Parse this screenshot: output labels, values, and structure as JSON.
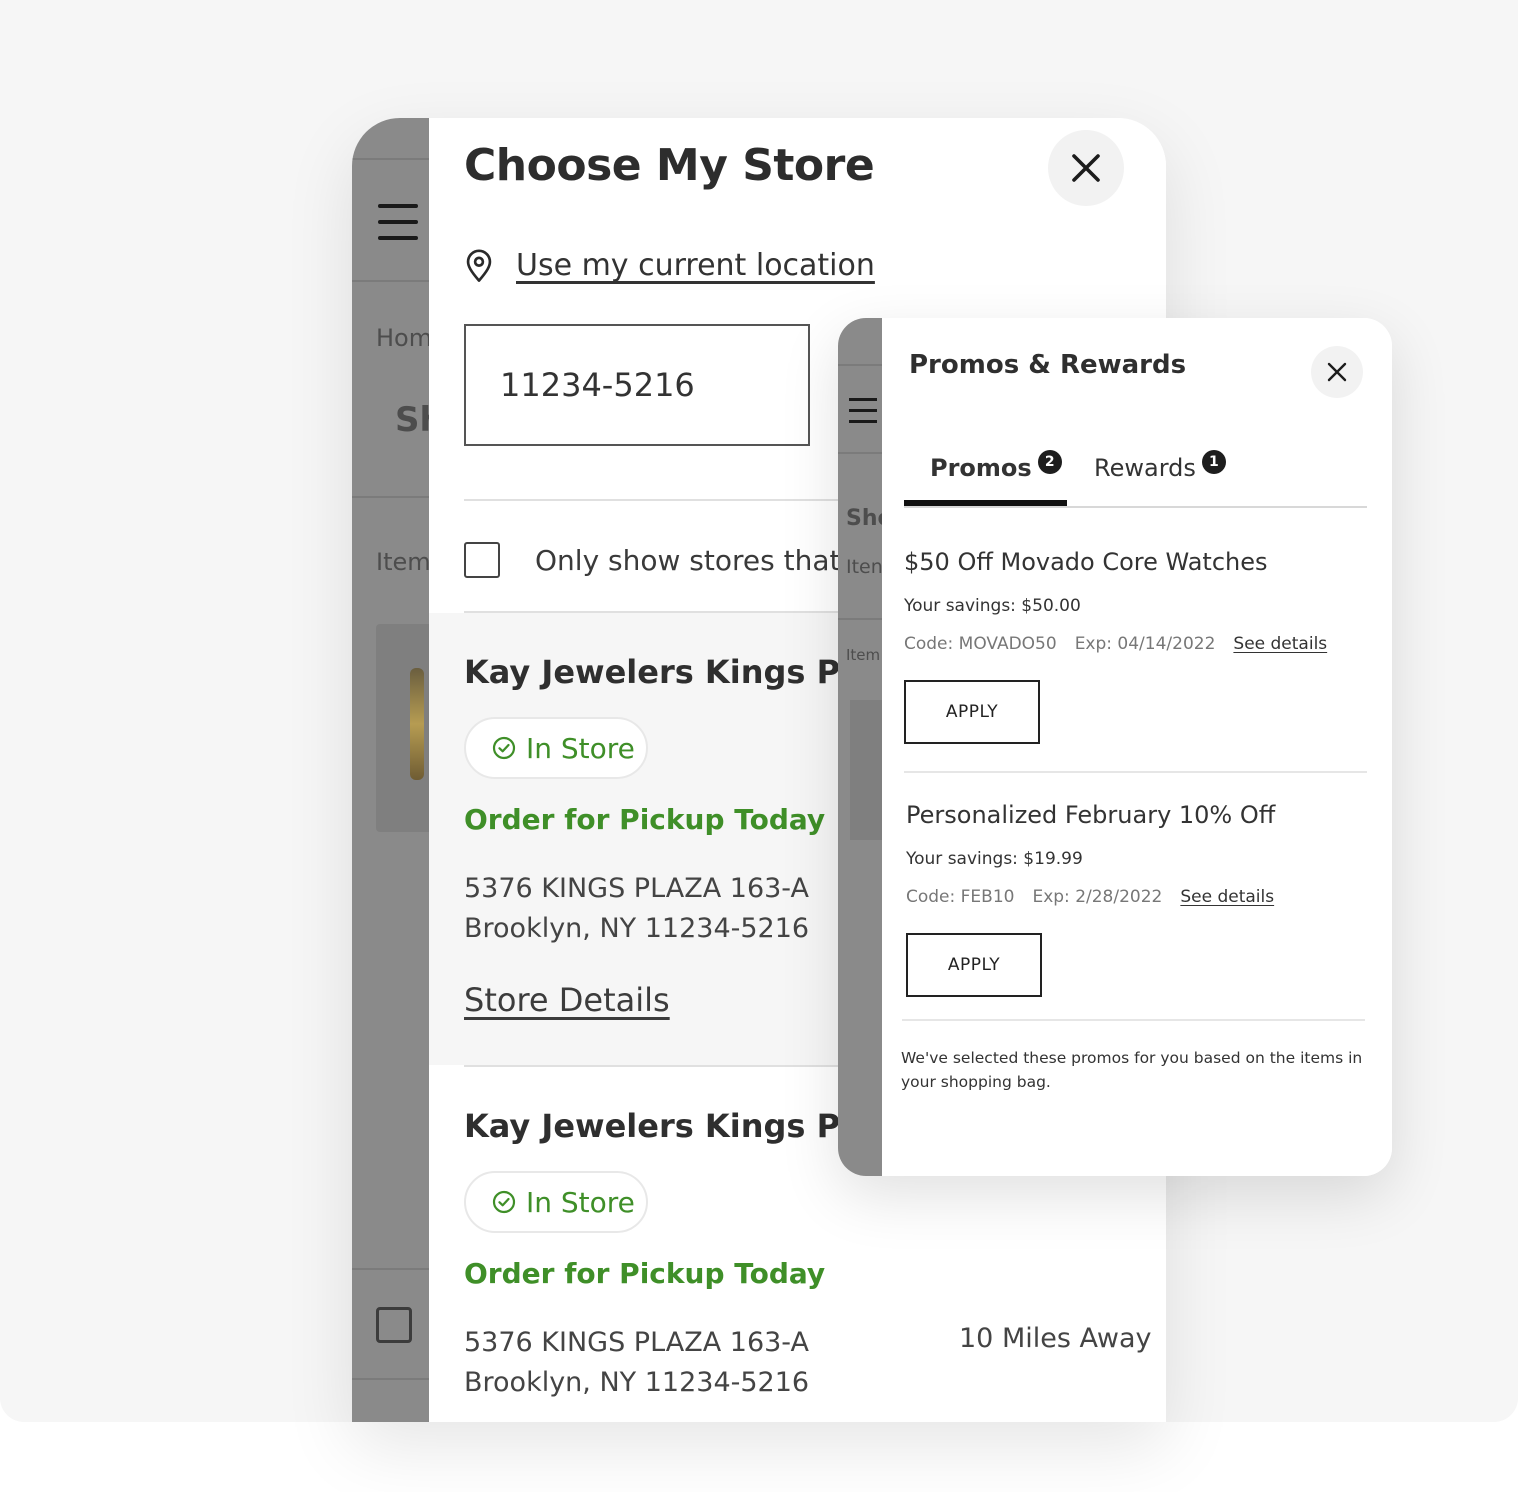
{
  "store_modal": {
    "title": "Choose My Store",
    "close_label": "close",
    "use_location_label": "Use my current location",
    "zip_value": "11234-5216",
    "filter_label": "Only show stores that ha",
    "stores": [
      {
        "name": "Kay Jewelers Kings Plaza",
        "status": "In Store",
        "pickup": "Order for Pickup Today",
        "address_line1": "5376 KINGS PLAZA 163-A",
        "address_line2": "Brooklyn, NY 11234-5216",
        "details_label": "Store Details"
      },
      {
        "name": "Kay Jewelers Kings Plaza",
        "status": "In Store",
        "pickup": "Order for Pickup Today",
        "address_line1": "5376 KINGS PLAZA 163-A",
        "address_line2": "Brooklyn, NY 11234-5216",
        "distance": "10 Miles Away"
      }
    ]
  },
  "background_page": {
    "breadcrumb_fragment": "Hom",
    "heading_fragment": "Sh",
    "items_fragment": "Item"
  },
  "promo_background": {
    "heading_fragment": "Sho",
    "items_fragment": "Iten",
    "sub_fragment": "Item"
  },
  "promo_modal": {
    "title": "Promos & Rewards",
    "tabs": [
      {
        "label": "Promos",
        "count": "2",
        "active": true
      },
      {
        "label": "Rewards",
        "count": "1",
        "active": false
      }
    ],
    "promos": [
      {
        "title": "$50 Off Movado Core Watches",
        "savings": "Your savings: $50.00",
        "code": "Code: MOVADO50",
        "exp": "Exp: 04/14/2022",
        "details_label": "See details",
        "apply_label": "APPLY"
      },
      {
        "title": "Personalized February 10% Off",
        "savings": "Your savings: $19.99",
        "code": "Code: FEB10",
        "exp": "Exp: 2/28/2022",
        "details_label": "See details",
        "apply_label": "APPLY"
      }
    ],
    "note": "We've selected these promos for you based on the items in your shopping bag."
  },
  "icons": [
    "close-icon",
    "location-pin-icon",
    "check-circle-icon",
    "hamburger-menu-icon"
  ],
  "colors": {
    "accent_green": "#3f8f28",
    "overlay_gray": "#8a8a8a",
    "canvas": "#f6f6f6",
    "text_dark": "#2f2f2f"
  }
}
